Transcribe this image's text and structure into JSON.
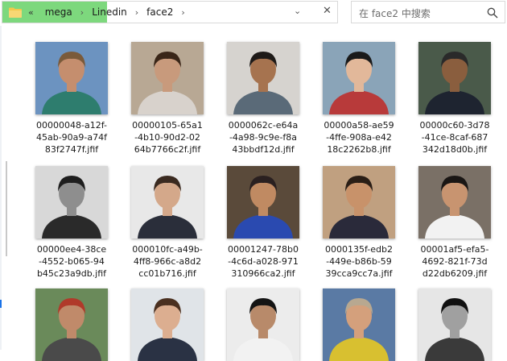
{
  "address_bar": {
    "breadcrumb": [
      {
        "label": "mega"
      },
      {
        "label": "Linedin"
      },
      {
        "label": "face2"
      }
    ],
    "overflow_glyph": "«",
    "separator_glyph": "›",
    "dropdown_glyph": "⌄",
    "clear_glyph": "✕"
  },
  "search": {
    "placeholder": "在 face2 中搜索"
  },
  "files": [
    {
      "lines": [
        "00000048-a12f-",
        "45ab-90a9-a74f",
        "83f2747f.jfif"
      ],
      "bg": "#6c93c0",
      "skin": "#c58e6e",
      "hair": "#7a5a3a",
      "cloth": "#2e7d6e"
    },
    {
      "lines": [
        "00000105-65a1",
        "-4b10-90d2-02",
        "64b7766c2f.jfif"
      ],
      "bg": "#b8a894",
      "skin": "#c89a7c",
      "hair": "#3a2618",
      "cloth": "#d8d2cc"
    },
    {
      "lines": [
        "0000062c-e64a",
        "-4a98-9c9e-f8a",
        "43bbdf12d.jfif"
      ],
      "bg": "#d6d3cf",
      "skin": "#a6734f",
      "hair": "#1e1a18",
      "cloth": "#5a6a78"
    },
    {
      "lines": [
        "00000a58-ae59",
        "-4ffe-908a-e42",
        "18c2262b8.jfif"
      ],
      "bg": "#8aa4b8",
      "skin": "#e2b89a",
      "hair": "#1a1a1a",
      "cloth": "#b83a3a"
    },
    {
      "lines": [
        "00000c60-3d78",
        "-41ce-8caf-687",
        "342d18d0b.jfif"
      ],
      "bg": "#4a5a4a",
      "skin": "#8a5e3e",
      "hair": "#2a2a2a",
      "cloth": "#1e2430"
    },
    {
      "lines": [
        "00000ee4-38ce",
        "-4552-b065-94",
        "b45c23a9db.jfif"
      ],
      "bg": "#d8d8d8",
      "skin": "#8e8e8e",
      "hair": "#1e1e1e",
      "cloth": "#2a2a2a"
    },
    {
      "lines": [
        "000010fc-a49b-",
        "4ff8-966c-a8d2",
        "cc01b716.jfif"
      ],
      "bg": "#e8e8e8",
      "skin": "#d4a88a",
      "hair": "#3a2a20",
      "cloth": "#2a2e3a"
    },
    {
      "lines": [
        "00001247-78b0",
        "-4c6d-a028-971",
        "310966ca2.jfif"
      ],
      "bg": "#5a4a3a",
      "skin": "#c08a62",
      "hair": "#2a2020",
      "cloth": "#2a4ab0"
    },
    {
      "lines": [
        "0000135f-edb2",
        "-449e-b86b-59",
        "39cca9cc7a.jfif"
      ],
      "bg": "#c0a080",
      "skin": "#c8926a",
      "hair": "#2a1e16",
      "cloth": "#2a2a3a"
    },
    {
      "lines": [
        "00001af5-efa5-",
        "4692-821f-73d",
        "d22db6209.jfif"
      ],
      "bg": "#7a7066",
      "skin": "#c89470",
      "hair": "#1a1614",
      "cloth": "#f2f2f2"
    },
    {
      "lines": [],
      "bg": "#6a8a5a",
      "skin": "#c08a6a",
      "hair": "#b03a2a",
      "cloth": "#4a4a4a"
    },
    {
      "lines": [],
      "bg": "#e0e4e8",
      "skin": "#dcae90",
      "hair": "#4a3020",
      "cloth": "#2a3244"
    },
    {
      "lines": [],
      "bg": "#ececec",
      "skin": "#b88a6a",
      "hair": "#141414",
      "cloth": "#f2f2f2"
    },
    {
      "lines": [],
      "bg": "#5a7aa4",
      "skin": "#d4a07c",
      "hair": "#b8a890",
      "cloth": "#d8c030"
    },
    {
      "lines": [],
      "bg": "#e6e6e6",
      "skin": "#a0a0a0",
      "hair": "#101010",
      "cloth": "#3a3a3a"
    }
  ]
}
